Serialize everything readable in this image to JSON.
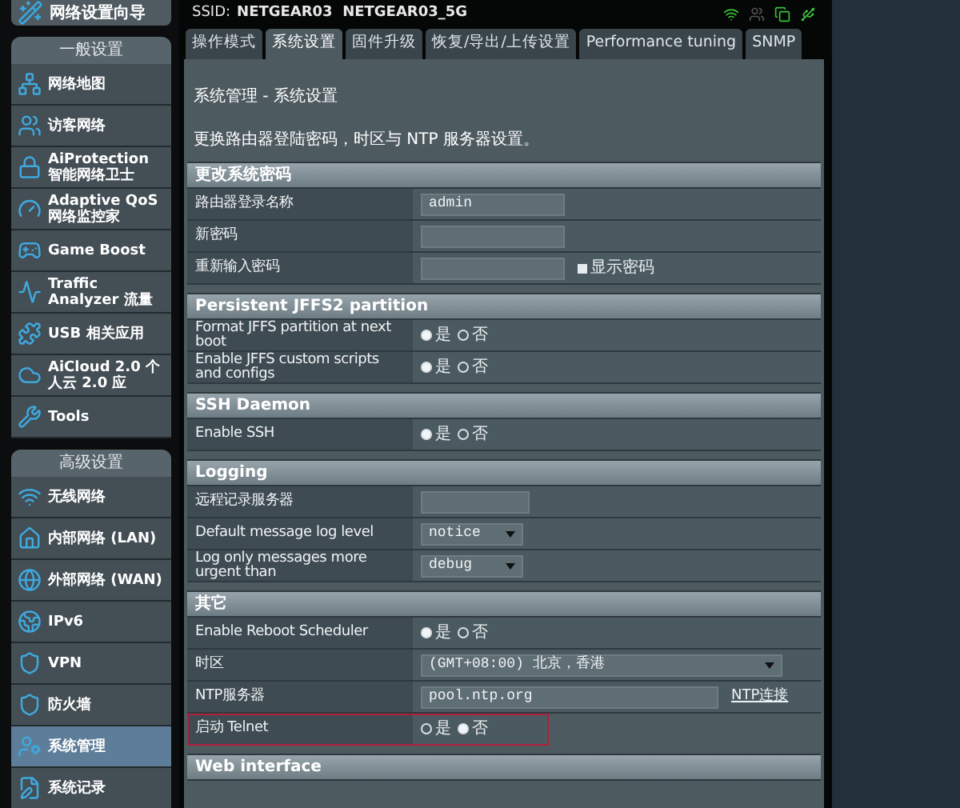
{
  "header": {
    "ssid_label": "SSID:",
    "ssid": "NETGEAR03  NETGEAR03_5G"
  },
  "sidebar": {
    "wizard": {
      "label": "网络设置向导"
    },
    "groups": [
      {
        "title": "一般设置",
        "items": [
          {
            "label": "网络地图",
            "selected": false
          },
          {
            "label": "访客网络",
            "selected": false
          },
          {
            "label": "AiProtection 智能网络卫士",
            "selected": false
          },
          {
            "label": "Adaptive QoS 网络监控家",
            "selected": false
          },
          {
            "label": "Game Boost",
            "selected": false
          },
          {
            "label": "Traffic Analyzer 流量",
            "selected": false
          },
          {
            "label": "USB 相关应用",
            "selected": false
          },
          {
            "label": "AiCloud 2.0 个人云 2.0 应",
            "selected": false
          },
          {
            "label": "Tools",
            "selected": false
          }
        ]
      },
      {
        "title": "高级设置",
        "items": [
          {
            "label": "无线网络",
            "selected": false
          },
          {
            "label": "内部网络 (LAN)",
            "selected": false
          },
          {
            "label": "外部网络 (WAN)",
            "selected": false
          },
          {
            "label": "IPv6",
            "selected": false
          },
          {
            "label": "VPN",
            "selected": false
          },
          {
            "label": "防火墙",
            "selected": false
          },
          {
            "label": "系统管理",
            "selected": true
          },
          {
            "label": "系统记录",
            "selected": false
          }
        ]
      }
    ]
  },
  "tabs": [
    {
      "label": "操作模式",
      "selected": false
    },
    {
      "label": "系统设置",
      "selected": true
    },
    {
      "label": "固件升级",
      "selected": false
    },
    {
      "label": "恢复/导出/上传设置",
      "selected": false
    },
    {
      "label": "Performance tuning",
      "selected": false
    },
    {
      "label": "SNMP",
      "selected": false
    }
  ],
  "page": {
    "title": "系统管理 - 系统设置",
    "description": "更换路由器登陆密码，时区与 NTP 服务器设置。",
    "sections": [
      {
        "title": "更改系统密码",
        "rows": [
          {
            "kind": "input",
            "label": "路由器登录名称",
            "value": "admin"
          },
          {
            "kind": "input",
            "label": "新密码"
          },
          {
            "kind": "input",
            "label": "重新输入密码",
            "checkbox": {
              "label": "显示密码",
              "checked": false
            }
          }
        ]
      },
      {
        "title": "Persistent JFFS2 partition",
        "rows": [
          {
            "kind": "radio",
            "label": "Format JFFS partition at next boot",
            "options": [
              {
                "label": "是",
                "selected": true
              },
              {
                "label": "否",
                "selected": false
              }
            ]
          },
          {
            "kind": "radio",
            "label": "Enable JFFS custom scripts and configs",
            "options": [
              {
                "label": "是",
                "selected": true
              },
              {
                "label": "否",
                "selected": false
              }
            ]
          }
        ]
      },
      {
        "title": "SSH Daemon",
        "rows": [
          {
            "kind": "radio",
            "label": "Enable SSH",
            "options": [
              {
                "label": "是",
                "selected": true
              },
              {
                "label": "否",
                "selected": false
              }
            ]
          }
        ]
      },
      {
        "title": "Logging",
        "rows": [
          {
            "kind": "input",
            "label": "远程记录服务器",
            "short": true
          },
          {
            "kind": "select",
            "label": "Default message log level",
            "value": "notice"
          },
          {
            "kind": "select",
            "label": "Log only messages more urgent than",
            "value": "debug"
          }
        ]
      },
      {
        "title": "其它",
        "rows": [
          {
            "kind": "radio",
            "label": "Enable Reboot Scheduler",
            "options": [
              {
                "label": "是",
                "selected": true
              },
              {
                "label": "否",
                "selected": false
              }
            ]
          },
          {
            "kind": "select",
            "label": "时区",
            "value": "(GMT+08:00) 北京，香港",
            "wide": true
          },
          {
            "kind": "input",
            "label": "NTP服务器",
            "value": "pool.ntp.org",
            "link": "NTP连接"
          },
          {
            "kind": "radio",
            "label": "启动 Telnet",
            "highlighted": true,
            "options": [
              {
                "label": "是",
                "selected": false
              },
              {
                "label": "否",
                "selected": true
              }
            ]
          }
        ]
      },
      {
        "title": "Web interface"
      }
    ]
  }
}
